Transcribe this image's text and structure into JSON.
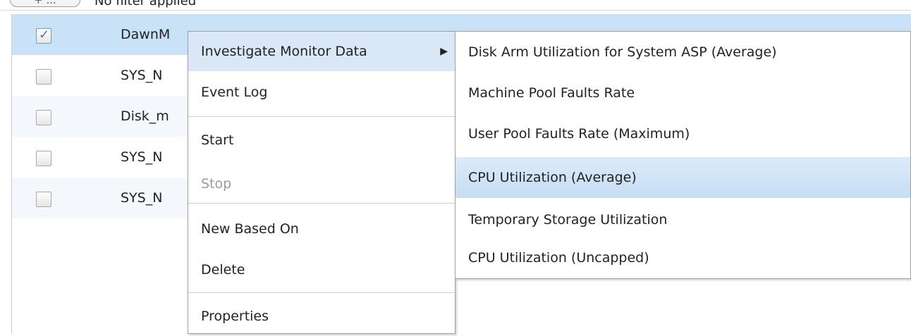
{
  "filter": {
    "button_label": "+ ...",
    "text": "No filter applied"
  },
  "rows": [
    {
      "name": "DawnM",
      "checked": true
    },
    {
      "name": "SYS_N",
      "checked": false
    },
    {
      "name": "Disk_m",
      "checked": false
    },
    {
      "name": "SYS_N",
      "checked": false
    },
    {
      "name": "SYS_N",
      "checked": false
    }
  ],
  "context_menu": {
    "items": [
      {
        "label": "Investigate Monitor Data",
        "has_submenu": true,
        "active": true
      },
      {
        "label": "Event Log"
      },
      {
        "label": "Start"
      },
      {
        "label": "Stop",
        "disabled": true
      },
      {
        "label": "New Based On"
      },
      {
        "label": "Delete"
      },
      {
        "label": "Properties"
      }
    ],
    "submenu_arrow": "▶"
  },
  "submenu": {
    "items": [
      {
        "label": "Disk Arm Utilization for System ASP (Average)"
      },
      {
        "label": "Machine Pool Faults Rate"
      },
      {
        "label": "User Pool Faults Rate (Maximum)"
      },
      {
        "label": "CPU Utilization (Average)",
        "highlighted": true
      },
      {
        "label": "Temporary Storage Utilization"
      },
      {
        "label": "CPU Utilization (Uncapped)"
      }
    ]
  },
  "colors": {
    "selected_row": "#c9e2f8",
    "menu_highlight": "#c6ddf4",
    "disabled_text": "#9a9a9a"
  }
}
